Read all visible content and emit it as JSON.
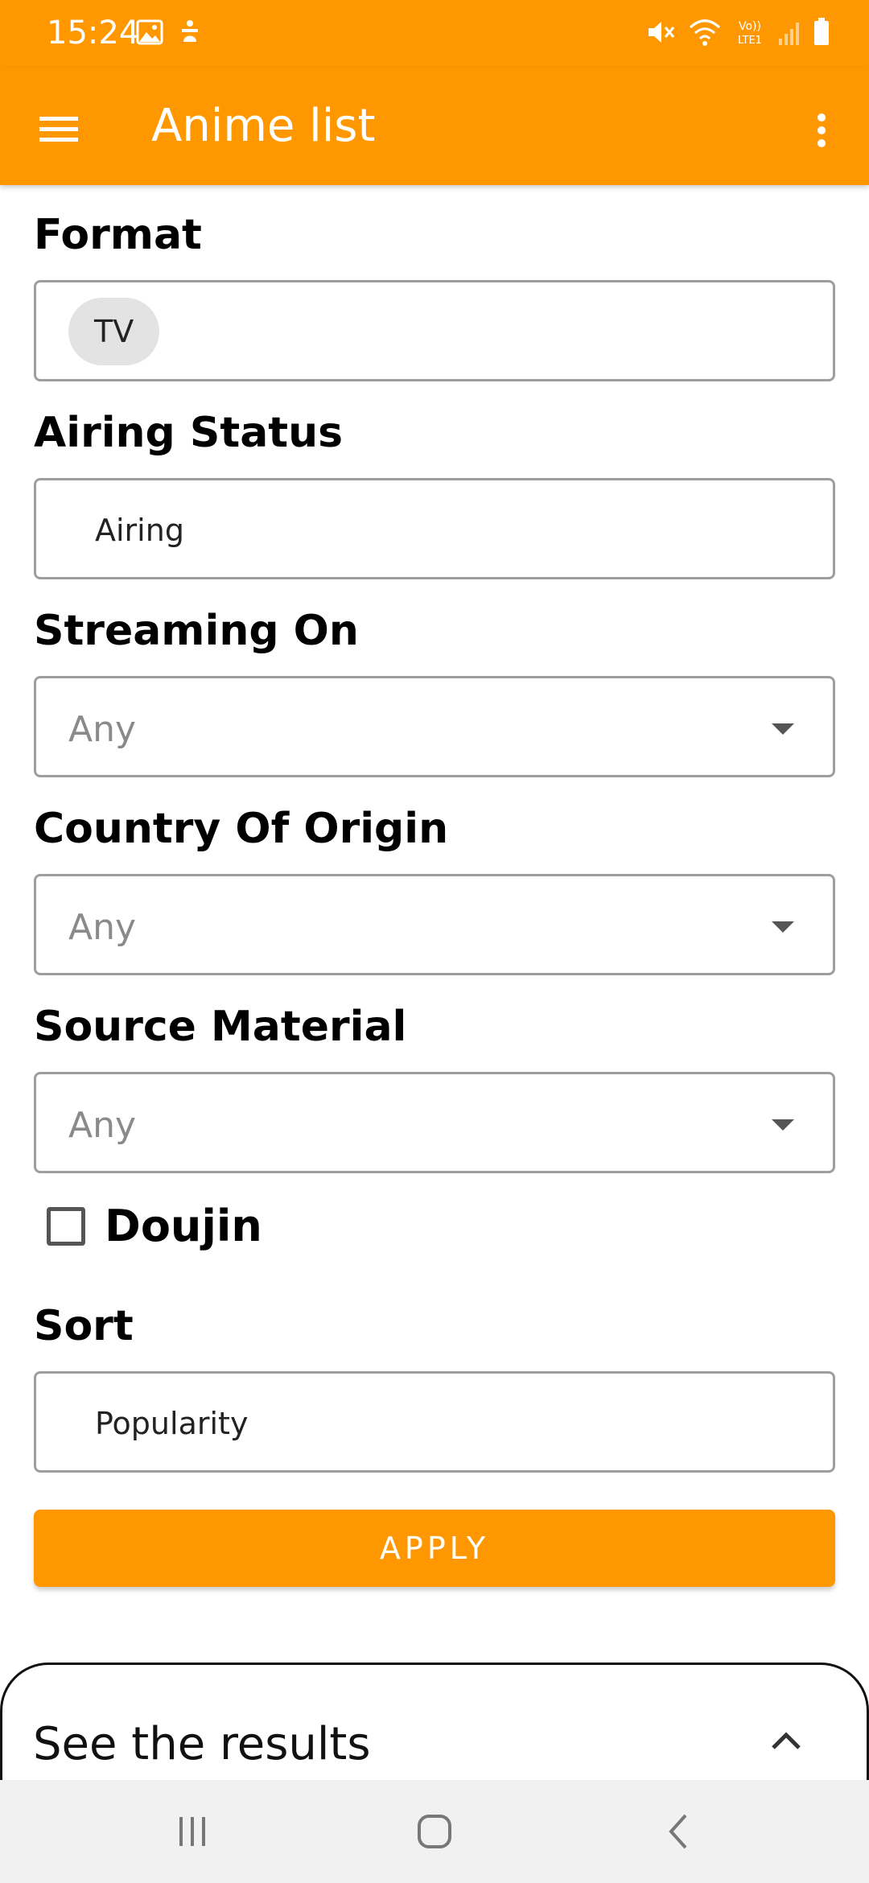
{
  "status_bar": {
    "time": "15:24",
    "left_icons": [
      "image-icon",
      "accessibility-icon"
    ],
    "right_icons": [
      "mute-icon",
      "wifi-icon",
      "volte-icon",
      "signal-icon",
      "battery-icon"
    ],
    "volte_text": "Vo)) LTE1"
  },
  "app_bar": {
    "title": "Anime list",
    "menu_icon": "hamburger-menu-icon",
    "overflow_icon": "more-vert-icon"
  },
  "form": {
    "format": {
      "label": "Format",
      "chip": "TV"
    },
    "airing_status": {
      "label": "Airing Status",
      "value": "Airing"
    },
    "streaming_on": {
      "label": "Streaming On",
      "value": "Any"
    },
    "country_of_origin": {
      "label": "Country Of Origin",
      "value": "Any"
    },
    "source_material": {
      "label": "Source Material",
      "value": "Any"
    },
    "doujin": {
      "label": "Doujin",
      "checked": false
    },
    "sort": {
      "label": "Sort",
      "value": "Popularity"
    },
    "apply_label": "APPLY"
  },
  "results": {
    "title": "See the results",
    "toggle_icon": "chevron-up-icon"
  },
  "colors": {
    "accent": "#ff9800",
    "border": "#9e9e9e",
    "chip_bg": "#e3e3e3"
  }
}
